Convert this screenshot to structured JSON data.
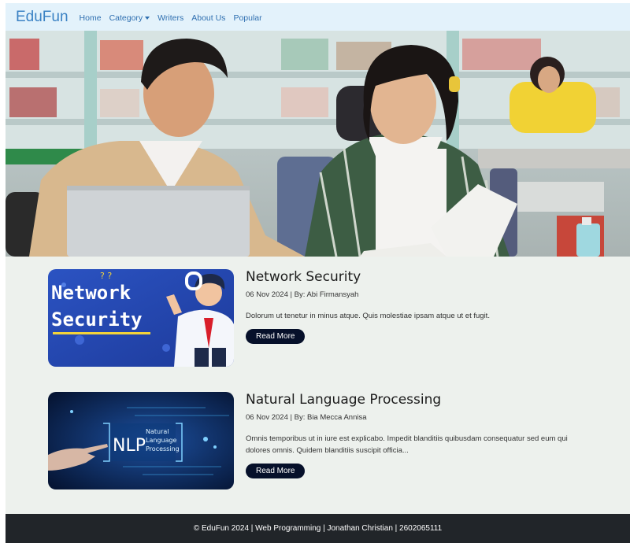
{
  "navbar": {
    "brand": "EduFun",
    "links": [
      {
        "label": "Home"
      },
      {
        "label": "Category"
      },
      {
        "label": "Writers"
      },
      {
        "label": "About Us"
      },
      {
        "label": "Popular"
      }
    ]
  },
  "articles": [
    {
      "title": "Network Security",
      "meta": "06 Nov 2024 | By: Abi Firmansyah",
      "excerpt": "Dolorum ut tenetur in minus atque. Quis molestiae ipsam atque ut et fugit.",
      "button": "Read More",
      "thumb_text": [
        "Network",
        "Security"
      ]
    },
    {
      "title": "Natural Language Processing",
      "meta": "06 Nov 2024 | By: Bia Mecca Annisa",
      "excerpt": "Omnis temporibus ut in iure est explicabo. Impedit blanditiis quibusdam consequatur sed eum qui dolores omnis. Quidem blanditiis suscipit officia...",
      "button": "Read More",
      "thumb_text": [
        "NLP",
        "Natural",
        "Language",
        "Processing"
      ]
    }
  ],
  "footer": {
    "text": "© EduFun 2024 | Web Programming | Jonathan Christian | 2602065111"
  },
  "colors": {
    "navbar_bg": "#e3f2fb",
    "brand": "#3b82c4",
    "main_bg": "#edf1ed",
    "button_bg": "#06102a",
    "footer_bg": "#212529"
  }
}
